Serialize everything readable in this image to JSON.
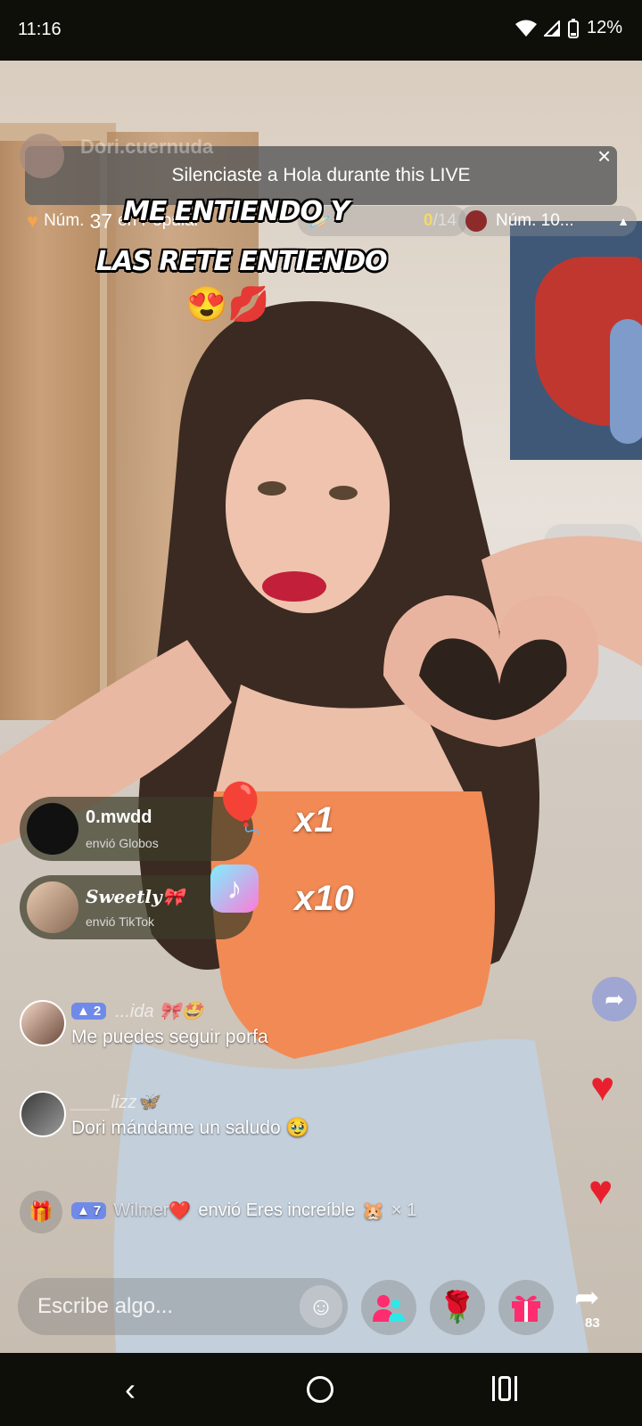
{
  "status": {
    "time": "11:16",
    "battery": "12%"
  },
  "notice": "Silenciaste a Hola durante this LIVE",
  "host": {
    "name": "Dori.cuernuda"
  },
  "ranking": {
    "popular_prefix": "Núm.",
    "popular_number": "37",
    "popular_suffix": "en Popular",
    "goal_current": "0",
    "goal_total": "/14",
    "rank2": "Núm. 10..."
  },
  "overlay": {
    "line1": "ME ENTIENDO Y",
    "line2": "LAS RETE ENTIENDO",
    "emojis": "😍💋"
  },
  "gifts": [
    {
      "user": "0.mwdd",
      "action": "envió Globos",
      "multiplier": "x1",
      "icon": "balloons-icon"
    },
    {
      "user": "Sweetly🎀",
      "action": "envió TikTok",
      "multiplier": "x10",
      "icon": "tiktok-gift-icon"
    }
  ],
  "comments": [
    {
      "level": "2",
      "user": "...ida 🎀🤩",
      "text": "Me puedes seguir porfa"
    },
    {
      "level": "",
      "user": "____lizz🦋",
      "text": "Dori mándame un saludo 🥹"
    }
  ],
  "gift_notice": {
    "level": "7",
    "user": "Wilmer",
    "heart": "❤️",
    "action": "envió Eres increíble",
    "emoji": "🐹",
    "multiplier": "× 1"
  },
  "input": {
    "placeholder": "Escribe algo..."
  },
  "share_count": "83",
  "colors": {
    "accent_pink": "#ff2d6f",
    "level_badge": "#6f8ae8",
    "heart": "#e8202e"
  }
}
